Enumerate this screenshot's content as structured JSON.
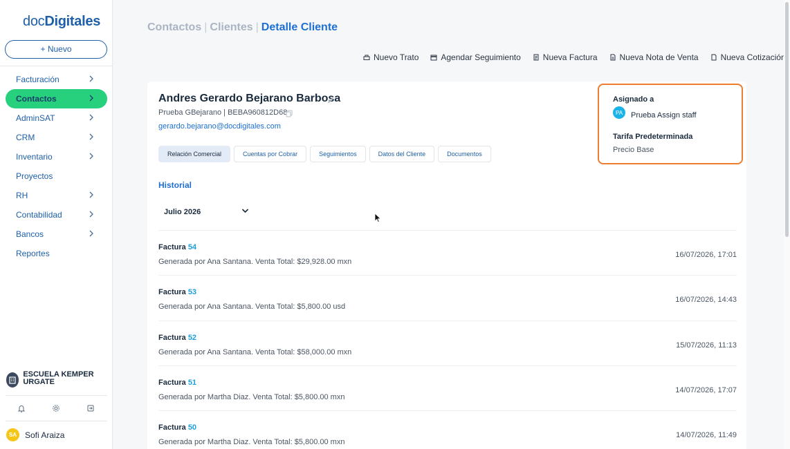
{
  "brand": {
    "logo_light": "doc",
    "logo_bold": "Digitales"
  },
  "sidebar": {
    "new_button": "+ Nuevo",
    "items": [
      {
        "label": "Facturación",
        "has_children": true,
        "active": false
      },
      {
        "label": "Contactos",
        "has_children": true,
        "active": true
      },
      {
        "label": "AdminSAT",
        "has_children": true,
        "active": false
      },
      {
        "label": "CRM",
        "has_children": true,
        "active": false
      },
      {
        "label": "Inventario",
        "has_children": true,
        "active": false
      },
      {
        "label": "Proyectos",
        "has_children": false,
        "active": false
      },
      {
        "label": "RH",
        "has_children": true,
        "active": false
      },
      {
        "label": "Contabilidad",
        "has_children": true,
        "active": false
      },
      {
        "label": "Bancos",
        "has_children": true,
        "active": false
      },
      {
        "label": "Reportes",
        "has_children": false,
        "active": false
      }
    ],
    "company": "ESCUELA KEMPER URGATE",
    "bottom_icons": [
      "bell-icon",
      "gear-icon",
      "logout-icon"
    ],
    "user": {
      "initials": "SA",
      "name": "Sofi Araiza"
    }
  },
  "breadcrumb": {
    "item1": "Contactos",
    "item2": "Clientes",
    "current": "Detalle Cliente",
    "separator": "|"
  },
  "actions": [
    {
      "label": "Nuevo Trato",
      "icon": "deal-icon"
    },
    {
      "label": "Agendar Seguimiento",
      "icon": "calendar-icon"
    },
    {
      "label": "Nueva Factura",
      "icon": "invoice-icon"
    },
    {
      "label": "Nueva Nota de Venta",
      "icon": "note-icon"
    },
    {
      "label": "Nueva Cotización",
      "icon": "quote-icon"
    }
  ],
  "client": {
    "name": "Andres Gerardo Bejarano Barbosa",
    "subtitle": "Prueba GBejarano | BEBA960812D68",
    "email": "gerardo.bejarano@docdigitales.com"
  },
  "tabs": [
    {
      "label": "Relación Comercial",
      "active": true
    },
    {
      "label": "Cuentas por Cobrar",
      "active": false
    },
    {
      "label": "Seguimientos",
      "active": false
    },
    {
      "label": "Datos del Cliente",
      "active": false
    },
    {
      "label": "Documentos",
      "active": false
    }
  ],
  "assign": {
    "assigned_label": "Asignado a",
    "staff_initials": "PA",
    "staff_name": "Prueba Assign staff",
    "rate_label": "Tarifa Predeterminada",
    "rate_value": "Precio Base",
    "highlight_color": "#ec7d2e"
  },
  "history": {
    "title": "Historial",
    "month": "Julio 2026",
    "entries": [
      {
        "type": "Factura",
        "number": "54",
        "description": "Generada por Ana Santana. Venta Total: $29,928.00 mxn",
        "datetime": "16/07/2026, 17:01"
      },
      {
        "type": "Factura",
        "number": "53",
        "description": "Generada por Ana Santana. Venta Total: $5,800.00 usd",
        "datetime": "16/07/2026, 14:43"
      },
      {
        "type": "Factura",
        "number": "52",
        "description": "Generada por Ana Santana. Venta Total: $58,000.00 mxn",
        "datetime": "15/07/2026, 11:13"
      },
      {
        "type": "Factura",
        "number": "51",
        "description": "Generada por Martha Diaz. Venta Total: $5,800.00 mxn",
        "datetime": "14/07/2026, 17:07"
      },
      {
        "type": "Factura",
        "number": "50",
        "description": "Generada por Martha Diaz. Venta Total: $5,800.00 mxn",
        "datetime": "14/07/2026, 11:49"
      }
    ]
  },
  "colors": {
    "brand_blue": "#1d5fa8",
    "active_green": "#26d07c",
    "link_blue": "#1d6fd1"
  }
}
